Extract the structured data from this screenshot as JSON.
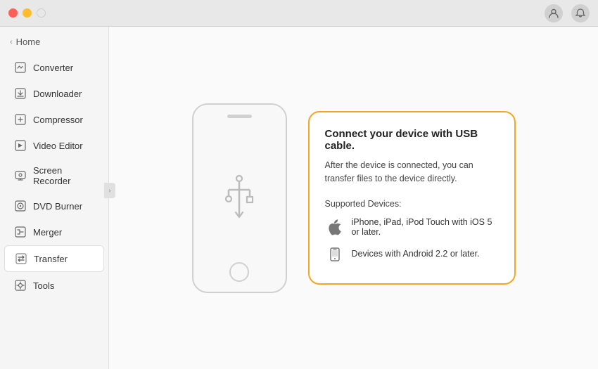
{
  "titlebar": {
    "profile_icon": "person",
    "notification_icon": "bell"
  },
  "sidebar": {
    "home_label": "Home",
    "chevron": "‹",
    "items": [
      {
        "id": "converter",
        "label": "Converter",
        "active": false
      },
      {
        "id": "downloader",
        "label": "Downloader",
        "active": false
      },
      {
        "id": "compressor",
        "label": "Compressor",
        "active": false
      },
      {
        "id": "video-editor",
        "label": "Video Editor",
        "active": false
      },
      {
        "id": "screen-recorder",
        "label": "Screen Recorder",
        "active": false
      },
      {
        "id": "dvd-burner",
        "label": "DVD Burner",
        "active": false
      },
      {
        "id": "merger",
        "label": "Merger",
        "active": false
      },
      {
        "id": "transfer",
        "label": "Transfer",
        "active": true
      },
      {
        "id": "tools",
        "label": "Tools",
        "active": false
      }
    ]
  },
  "main": {
    "card": {
      "title": "Connect your device with USB cable.",
      "description": "After the device is connected, you can transfer files to the device directly.",
      "supported_label": "Supported Devices:",
      "devices": [
        {
          "id": "apple",
          "text": "iPhone, iPad, iPod Touch with iOS 5 or later."
        },
        {
          "id": "android",
          "text": "Devices with Android 2.2 or later."
        }
      ]
    }
  },
  "colors": {
    "accent": "#f5a623",
    "active_bg": "#ffffff",
    "sidebar_bg": "#f5f5f5"
  }
}
